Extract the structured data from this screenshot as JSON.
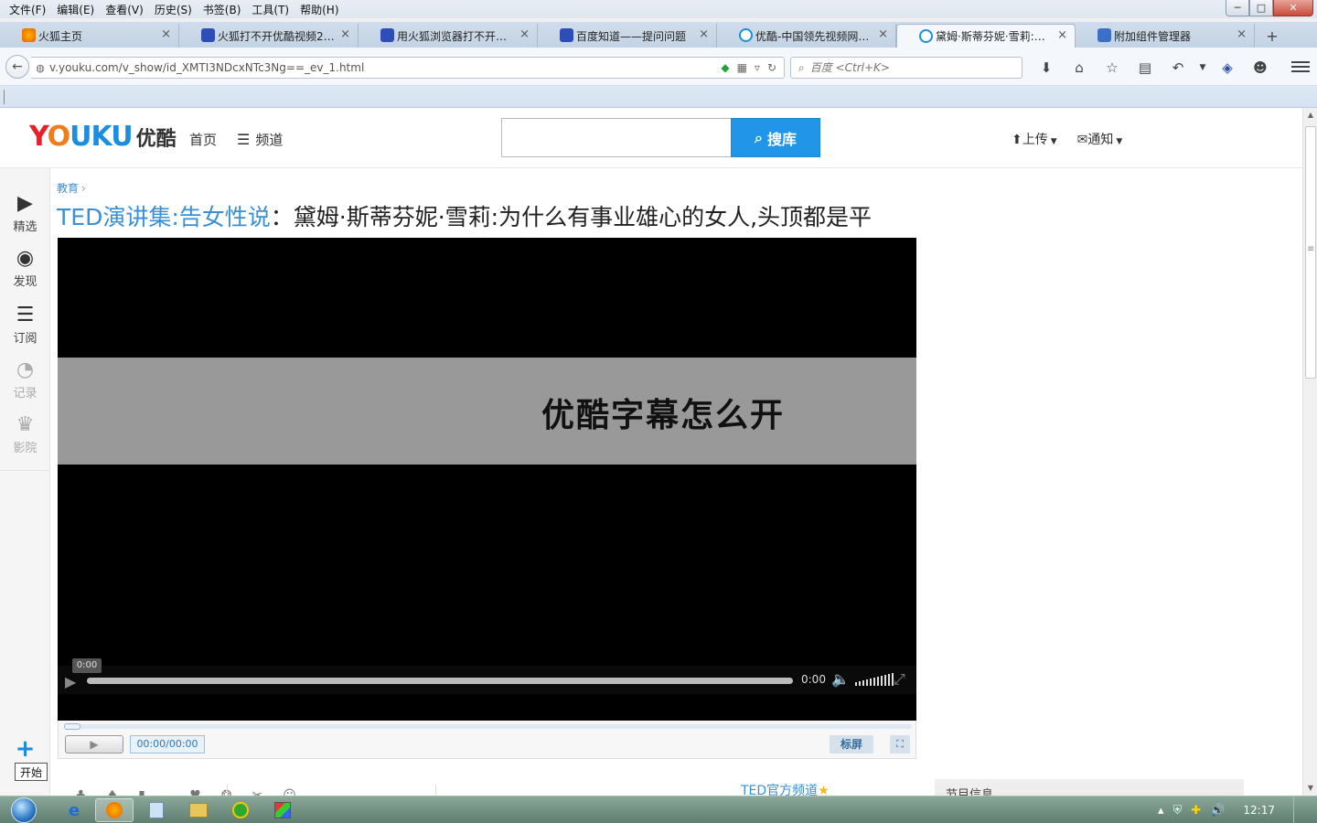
{
  "menubar": {
    "items": [
      "文件(F)",
      "编辑(E)",
      "查看(V)",
      "历史(S)",
      "书签(B)",
      "工具(T)",
      "帮助(H)"
    ]
  },
  "window_controls": {
    "minimize": "─",
    "maximize": "□",
    "close": "✕"
  },
  "tabs": [
    {
      "label": "火狐主页",
      "icon_color": "#e66000"
    },
    {
      "label": "火狐打不开优酷视频20...",
      "icon_color": "#2f4db7"
    },
    {
      "label": "用火狐浏览器打不开优...",
      "icon_color": "#2f4db7"
    },
    {
      "label": "百度知道——提问问题",
      "icon_color": "#2f4db7"
    },
    {
      "label": "优酷-中国领先视频网站...",
      "icon_color": "#1b8ee0"
    },
    {
      "label": "黛姆·斯蒂芬妮·雪莉:为...",
      "icon_color": "#1b8ee0"
    },
    {
      "label": "附加组件管理器",
      "icon_color": "#3b6fc8"
    }
  ],
  "tab_close_glyph": "×",
  "new_tab_glyph": "+",
  "navbar": {
    "back_glyph": "←",
    "url": "v.youku.com/v_show/id_XMTI3NDcxNTc3Ng==_ev_1.html",
    "search_placeholder": "百度 <Ctrl+K>",
    "icons": [
      "download-icon",
      "home-icon",
      "star-icon",
      "reader-icon",
      "undo-icon",
      "dropdown-icon",
      "abp-icon",
      "chat-icon"
    ]
  },
  "youku": {
    "logo_en": [
      "Y",
      "O",
      "U",
      "K",
      "U"
    ],
    "logo_colors": [
      "#e8202a",
      "#f07d1b",
      "#1b8ee0",
      "#1b8ee0",
      "#1b8ee0"
    ],
    "logo_cn": "优酷",
    "nav_home": "首页",
    "nav_channel": "频道",
    "search_value": "",
    "search_button": "搜库",
    "upload": "上传",
    "notify": "通知"
  },
  "side_nav": [
    {
      "label": "精选",
      "icon": "▶"
    },
    {
      "label": "发现",
      "icon": "◉"
    },
    {
      "label": "订阅",
      "icon": "☰"
    },
    {
      "label": "记录",
      "icon": "◔"
    },
    {
      "label": "影院",
      "icon": "♛"
    }
  ],
  "side_add_glyph": "+",
  "start_tip": "开始",
  "breadcrumb": {
    "category": "教育",
    "chevron": "›"
  },
  "title": {
    "series": "TED演讲集:告女性说",
    "separator": "：",
    "name": "黛姆·斯蒂芬妮·雪莉:为什么有事业雄心的女人,头顶都是平"
  },
  "player": {
    "subtitle": "优酷字幕怎么开",
    "time_tooltip": "0:00",
    "time_right": "0:00",
    "progress_fraction": 0.0
  },
  "under_bar": {
    "time": "00:00/00:00",
    "standard": "标屏"
  },
  "below": {
    "ted_channel": "TED官方频道",
    "info_box": "节目信息"
  },
  "taskbar": {
    "clock": "12:17"
  }
}
